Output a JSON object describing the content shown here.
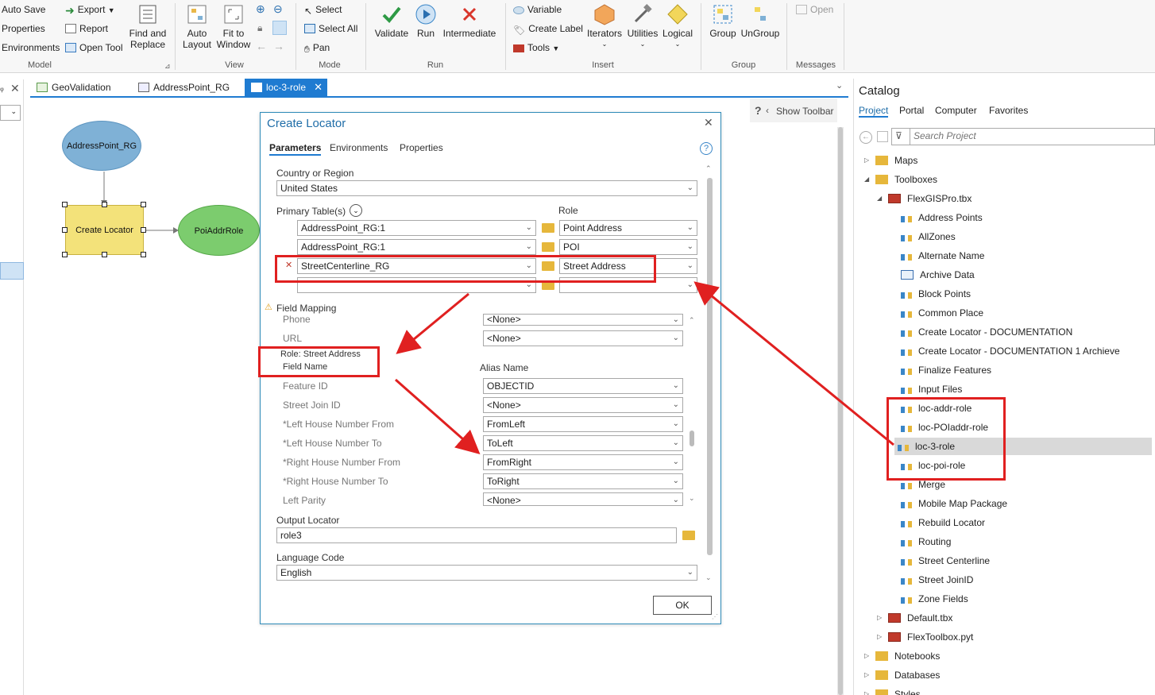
{
  "ribbon": {
    "model_group": {
      "label": "Model",
      "auto_save": "Auto Save",
      "properties": "Properties",
      "environments": "Environments",
      "export": "Export",
      "report": "Report",
      "open_tool": "Open Tool",
      "find_replace_1": "Find and",
      "find_replace_2": "Replace"
    },
    "view_group": {
      "label": "View",
      "auto_layout_1": "Auto",
      "auto_layout_2": "Layout",
      "fit_window_1": "Fit to",
      "fit_window_2": "Window"
    },
    "mode_group": {
      "label": "Mode",
      "select": "Select",
      "select_all": "Select All",
      "pan": "Pan"
    },
    "run_group": {
      "label": "Run",
      "validate": "Validate",
      "run": "Run",
      "intermediate": "Intermediate"
    },
    "insert_group": {
      "label": "Insert",
      "variable": "Variable",
      "create_label": "Create Label",
      "tools": "Tools",
      "iterators": "Iterators",
      "utilities": "Utilities",
      "logical": "Logical"
    },
    "group_group": {
      "label": "Group",
      "group": "Group",
      "ungroup": "UnGroup"
    },
    "messages_group": {
      "label": "Messages",
      "open": "Open"
    }
  },
  "tabs": [
    {
      "label": "GeoValidation"
    },
    {
      "label": "AddressPoint_RG"
    },
    {
      "label": "loc-3-role"
    }
  ],
  "canvas": {
    "show_toolbar": "Show Toolbar",
    "node_input": "AddressPoint_RG",
    "node_tool": "Create Locator",
    "node_output": "PoiAddrRole"
  },
  "dialog": {
    "title": "Create Locator",
    "tabs": [
      "Parameters",
      "Environments",
      "Properties"
    ],
    "country_label": "Country or Region",
    "country_value": "United States",
    "primary_tables_label": "Primary Table(s)",
    "role_label": "Role",
    "table_rows": [
      {
        "table": "AddressPoint_RG:1",
        "role": "Point Address"
      },
      {
        "table": "AddressPoint_RG:1",
        "role": "POI"
      },
      {
        "table": "StreetCenterline_RG",
        "role": "Street Address"
      },
      {
        "table": "",
        "role": ""
      }
    ],
    "field_mapping_label": "Field Mapping",
    "role_field_label_1": "Role: Street Address",
    "role_field_label_2": "Field Name",
    "alias_label": "Alias Name",
    "mappings_top": [
      {
        "field": "Phone",
        "value": "<None>"
      },
      {
        "field": "URL",
        "value": "<None>"
      }
    ],
    "mappings": [
      {
        "field": "Feature ID",
        "value": "OBJECTID"
      },
      {
        "field": "Street Join ID",
        "value": "<None>"
      },
      {
        "field": "*Left House Number From",
        "value": "FromLeft"
      },
      {
        "field": "*Left House Number To",
        "value": "ToLeft"
      },
      {
        "field": "*Right House Number From",
        "value": "FromRight"
      },
      {
        "field": "*Right House Number To",
        "value": "ToRight"
      },
      {
        "field": "Left Parity",
        "value": "<None>"
      }
    ],
    "output_label": "Output Locator",
    "output_value": "role3",
    "language_label": "Language Code",
    "language_value": "English",
    "ok": "OK"
  },
  "catalog": {
    "title": "Catalog",
    "tabs": [
      "Project",
      "Portal",
      "Computer",
      "Favorites"
    ],
    "search_placeholder": "Search Project",
    "items": [
      {
        "label": "Maps"
      },
      {
        "label": "Toolboxes"
      },
      {
        "label": "FlexGISPro.tbx"
      },
      {
        "label": "Address Points"
      },
      {
        "label": "AllZones"
      },
      {
        "label": "Alternate Name"
      },
      {
        "label": "Archive Data"
      },
      {
        "label": "Block Points"
      },
      {
        "label": "Common Place"
      },
      {
        "label": "Create Locator - DOCUMENTATION"
      },
      {
        "label": "Create Locator - DOCUMENTATION 1 Archieve"
      },
      {
        "label": "Finalize Features"
      },
      {
        "label": "Input Files"
      },
      {
        "label": "loc-addr-role"
      },
      {
        "label": "loc-POIaddr-role"
      },
      {
        "label": "loc-3-role"
      },
      {
        "label": "loc-poi-role"
      },
      {
        "label": "Merge"
      },
      {
        "label": "Mobile Map Package"
      },
      {
        "label": "Rebuild Locator"
      },
      {
        "label": "Routing"
      },
      {
        "label": "Street Centerline"
      },
      {
        "label": "Street JoinID"
      },
      {
        "label": "Zone Fields"
      },
      {
        "label": "Default.tbx"
      },
      {
        "label": "FlexToolbox.pyt"
      },
      {
        "label": "Notebooks"
      },
      {
        "label": "Databases"
      },
      {
        "label": "Styles"
      }
    ]
  },
  "colors": {
    "accent": "#1f7bd1",
    "annotation_red": "#e02020",
    "node_blue": "#7fb1d6",
    "node_yellow": "#f3e27a",
    "node_green": "#7ccc6e"
  }
}
